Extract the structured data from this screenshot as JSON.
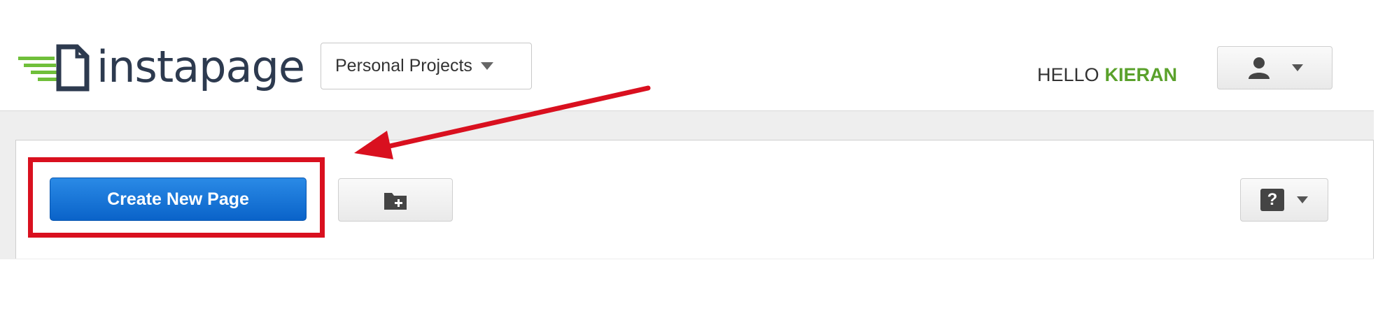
{
  "header": {
    "logo_text": "instapage",
    "project_selector": {
      "selected": "Personal Projects"
    },
    "greeting": {
      "prefix": "HELLO",
      "name": "KIERAN"
    },
    "user_menu_icon": "user-icon"
  },
  "toolbar": {
    "create_label": "Create New Page",
    "new_folder_icon": "folder-plus-icon",
    "help_icon": "question-mark-icon",
    "help_text": "?"
  },
  "annotation": {
    "color": "#d9101f",
    "target": "Create New Page"
  },
  "colors": {
    "brand_green": "#5aa12b",
    "primary_blue": "#0a63c9",
    "logo_text": "#2d3a4f"
  }
}
